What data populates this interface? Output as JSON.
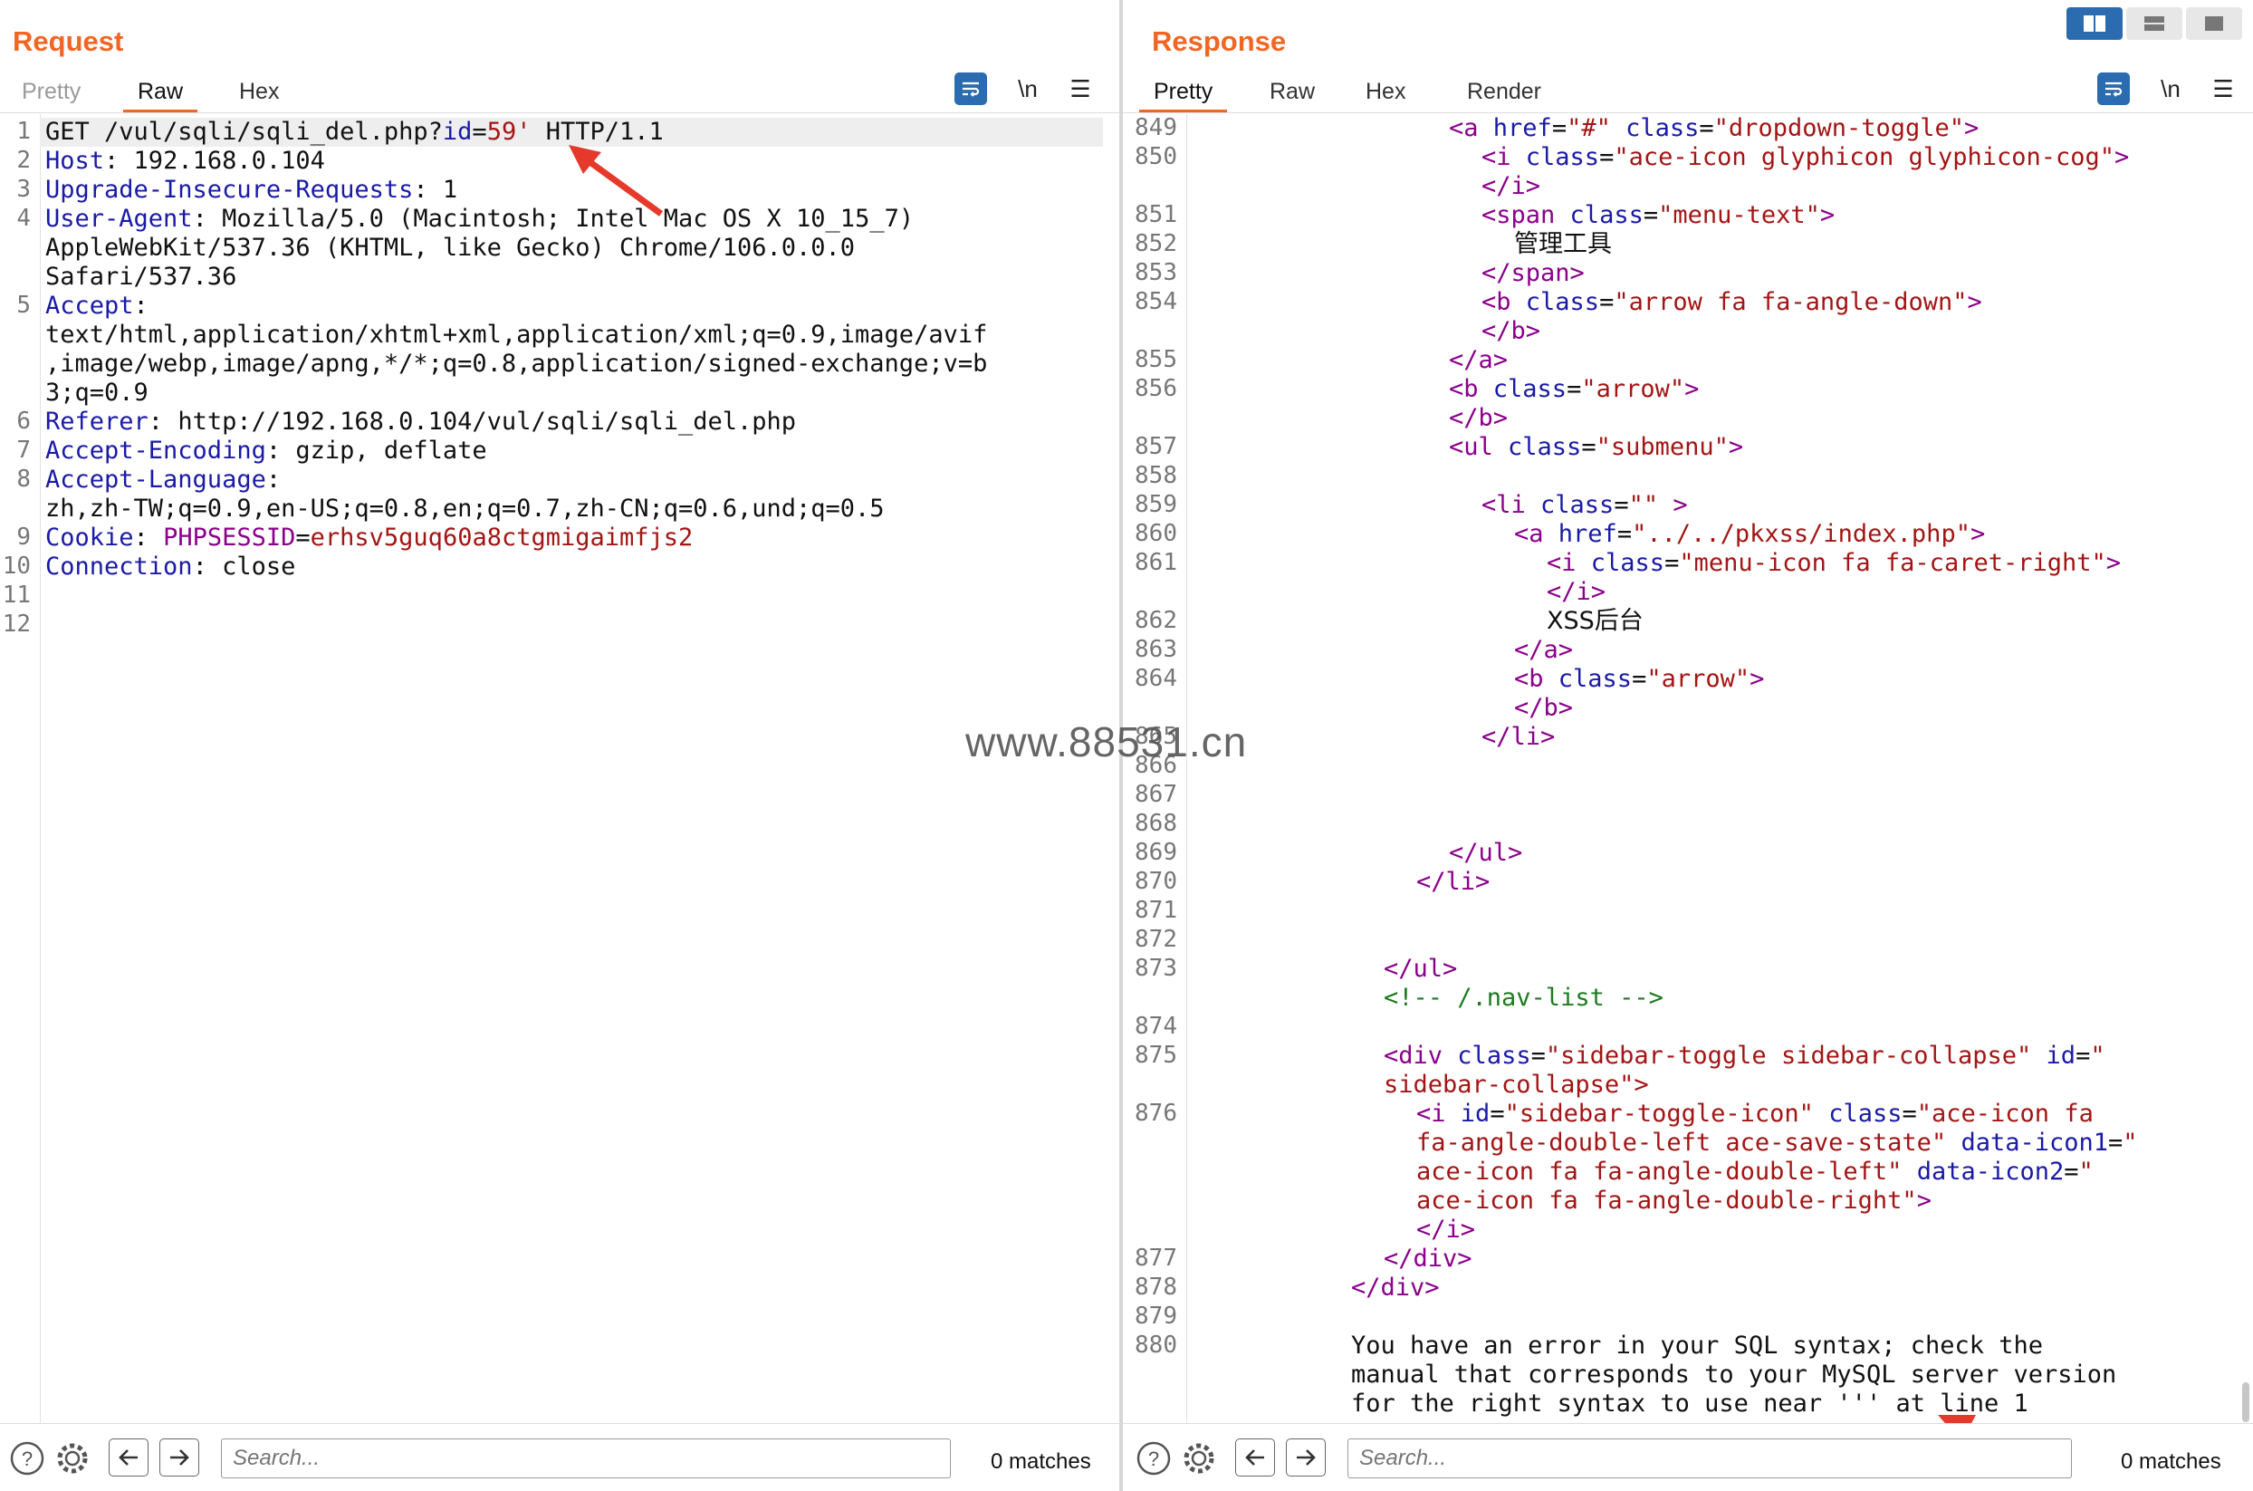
{
  "colors": {
    "accent": "#f26522",
    "tool_blue": "#2b6cb0"
  },
  "request": {
    "title": "Request",
    "tabs": [
      "Pretty",
      "Raw",
      "Hex"
    ],
    "active_tab": "Raw",
    "newline_toggle": "\\n",
    "line_numbers": [
      "1",
      "2",
      "3",
      "4",
      "",
      "",
      "5",
      "",
      "",
      "",
      "6",
      "7",
      "8",
      "",
      "9",
      "10",
      "11",
      "12"
    ],
    "line1": {
      "method_path": "GET /vul/sqli/sqli_del.php?",
      "param": "id",
      "eq": "=",
      "value": "59'",
      "rest": " HTTP/1.1"
    },
    "headers": [
      {
        "name": "Host",
        "value": " 192.168.0.104"
      },
      {
        "name": "Upgrade-Insecure-Requests",
        "value": " 1"
      },
      {
        "name": "User-Agent",
        "value": " Mozilla/5.0 (Macintosh; Intel Mac OS X 10_15_7)"
      },
      {
        "name": "",
        "value": "AppleWebKit/537.36 (KHTML, like Gecko) Chrome/106.0.0.0"
      },
      {
        "name": "",
        "value": "Safari/537.36"
      },
      {
        "name": "Accept",
        "value": ""
      },
      {
        "name": "",
        "value": "text/html,application/xhtml+xml,application/xml;q=0.9,image/avif"
      },
      {
        "name": "",
        "value": ",image/webp,image/apng,*/*;q=0.8,application/signed-exchange;v=b"
      },
      {
        "name": "",
        "value": "3;q=0.9"
      },
      {
        "name": "Referer",
        "value": " http://192.168.0.104/vul/sqli/sqli_del.php"
      },
      {
        "name": "Accept-Encoding",
        "value": " gzip, deflate"
      },
      {
        "name": "Accept-Language",
        "value": ""
      },
      {
        "name": "",
        "value": "zh,zh-TW;q=0.9,en-US;q=0.8,en;q=0.7,zh-CN;q=0.6,und;q=0.5"
      }
    ],
    "cookie": {
      "name": "Cookie",
      "cname": "PHPSESSID",
      "cval": "erhsv5guq60a8ctgmigaimfjs2"
    },
    "connection": {
      "name": "Connection",
      "value": " close"
    },
    "search_placeholder": "Search...",
    "matches": "0 matches"
  },
  "response": {
    "title": "Response",
    "tabs": [
      "Pretty",
      "Raw",
      "Hex",
      "Render"
    ],
    "active_tab": "Pretty",
    "newline_toggle": "\\n",
    "line_numbers": [
      "849",
      "850",
      "",
      "851",
      "852",
      "853",
      "854",
      "",
      "855",
      "856",
      "",
      "857",
      "858",
      "859",
      "860",
      "861",
      "",
      "862",
      "863",
      "864",
      "",
      "865",
      "866",
      "867",
      "868",
      "869",
      "870",
      "871",
      "872",
      "873",
      "",
      "874",
      "875",
      "",
      "876",
      "",
      "",
      "",
      "",
      "877",
      "878",
      "879",
      "880",
      "",
      ""
    ],
    "code": {
      "l849": [
        "<",
        "a",
        " href",
        "=",
        "\"#\"",
        " class",
        "=",
        "\"dropdown-toggle\"",
        ">"
      ],
      "l850": [
        "<",
        "i",
        " class",
        "=",
        "\"ace-icon glyphicon glyphicon-cog\"",
        ">"
      ],
      "l850b": [
        "</",
        "i",
        ">"
      ],
      "l851": [
        "<",
        "span",
        " class",
        "=",
        "\"menu-text\"",
        ">"
      ],
      "l852": "管理工具",
      "l853": [
        "</",
        "span",
        ">"
      ],
      "l854": [
        "<",
        "b",
        " class",
        "=",
        "\"arrow fa fa-angle-down\"",
        ">"
      ],
      "l854b": [
        "</",
        "b",
        ">"
      ],
      "l855": [
        "</",
        "a",
        ">"
      ],
      "l856": [
        "<",
        "b",
        " class",
        "=",
        "\"arrow\"",
        ">"
      ],
      "l856b": [
        "</",
        "b",
        ">"
      ],
      "l857": [
        "<",
        "ul",
        " class",
        "=",
        "\"submenu\"",
        ">"
      ],
      "l859": [
        "<",
        "li",
        " class",
        "=",
        "\"\"",
        " >"
      ],
      "l860": [
        "<",
        "a",
        " href",
        "=",
        "\"../../pkxss/index.php\"",
        ">"
      ],
      "l861": [
        "<",
        "i",
        " class",
        "=",
        "\"menu-icon fa fa-caret-right\"",
        ">"
      ],
      "l861b": [
        "</",
        "i",
        ">"
      ],
      "l862": "XSS后台",
      "l863": [
        "</",
        "a",
        ">"
      ],
      "l864": [
        "<",
        "b",
        " class",
        "=",
        "\"arrow\"",
        ">"
      ],
      "l864b": [
        "</",
        "b",
        ">"
      ],
      "l865": [
        "</",
        "li",
        ">"
      ],
      "l869": [
        "</",
        "ul",
        ">"
      ],
      "l870": [
        "</",
        "li",
        ">"
      ],
      "l873": [
        "</",
        "ul",
        ">"
      ],
      "l873b": "<!-- /.nav-list -->",
      "l875a": [
        "<",
        "div",
        " class",
        "=",
        "\"sidebar-toggle sidebar-collapse\"",
        " id",
        "=",
        "\""
      ],
      "l875b": "sidebar-collapse\">",
      "l876a": [
        "<",
        "i",
        " id",
        "=",
        "\"sidebar-toggle-icon\"",
        " class",
        "=",
        "\"ace-icon fa"
      ],
      "l876b": [
        "fa-angle-double-left ace-save-state\"",
        " data-icon1",
        "=",
        "\""
      ],
      "l876c": [
        "ace-icon fa fa-angle-double-left\"",
        " data-icon2",
        "=",
        "\""
      ],
      "l876d": [
        "ace-icon fa fa-angle-double-right\"",
        ">"
      ],
      "l876e": [
        "</",
        "i",
        ">"
      ],
      "l877": [
        "</",
        "div",
        ">"
      ],
      "l878": [
        "</",
        "div",
        ">"
      ],
      "l880a": "You have an error in your SQL syntax; check the",
      "l880b": "manual that corresponds to your MySQL server version",
      "l880c": "for the right syntax to use near ''' at line 1"
    },
    "search_placeholder": "Search...",
    "matches": "0 matches"
  },
  "watermark": "www.88531.cn"
}
